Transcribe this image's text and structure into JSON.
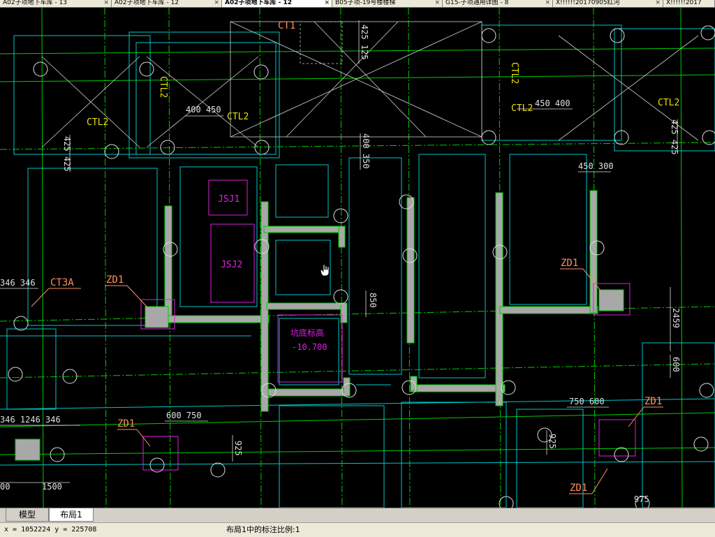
{
  "doc_tabs": [
    {
      "label": "A02子项地下车库 - 13",
      "active": false
    },
    {
      "label": "A02子项地下车库 - 12",
      "active": false
    },
    {
      "label": "A02子项地下车库 - 12",
      "active": true
    },
    {
      "label": "B05子项-19号楼楼梯",
      "active": false
    },
    {
      "label": "G15-子项通用详图 - 8",
      "active": false
    },
    {
      "label": "X!!!!!!20170905红河",
      "active": false
    },
    {
      "label": "X!!!!!!2017",
      "active": false
    }
  ],
  "drawing": {
    "labels": {
      "ct1": "CT1",
      "ctl2_a": "CTL2",
      "ctl2_b": "CTL2",
      "ctl2_c": "CTL2",
      "ctl2_d": "CTL2",
      "ctl2_e": "CTL2",
      "ctl2_f": "CTL2",
      "ct3a": "CT3A",
      "zd1_a": "ZD1",
      "zd1_b": "ZD1",
      "zd1_c": "ZD1",
      "zd1_d": "ZD1",
      "zd1_e": "ZD1",
      "jsj1": "JSJ1",
      "jsj2": "JSJ2",
      "pit_title": "坑底标高",
      "pit_value": "-10.700"
    },
    "dims": {
      "d425_125_top": "425 125",
      "d400_450": "400 450",
      "d450_400": "450 400",
      "d425_425_left": "425 425",
      "d400_350": "400 350",
      "d450_300": "450 300",
      "d425_425_right": "425 425",
      "d850": "850",
      "d2459": "2459",
      "d600_right": "600",
      "d346_346_top": "346 346",
      "d346_1246_346": "346 1246 346",
      "d600_750": "600 750",
      "d925_a": "925",
      "d750_600": "750 600",
      "d925_b": "925",
      "d1500": "1500",
      "d00": "00",
      "d975": "975"
    }
  },
  "layout_tabs": {
    "model": "模型",
    "layout1": "布局1"
  },
  "status": {
    "coords": "x = 1052224  y = 225708",
    "message": "布局1中的标注比例:1"
  },
  "colors": {
    "background": "#000000",
    "grid_green": "#00cc00",
    "outline_cyan": "#00c8c8",
    "wall_gray": "#a8a8a8",
    "annotation_yellow": "#e8e000",
    "leader_orange": "#ff9060",
    "equipment_magenta": "#e020e0",
    "dim_white": "#e0e0e0"
  }
}
